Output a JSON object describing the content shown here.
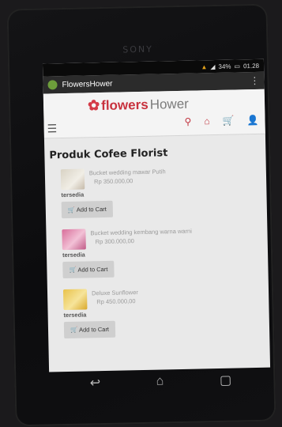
{
  "phone": {
    "brand": "SONY"
  },
  "status_bar": {
    "clock": "01.28",
    "signal_text": "34%"
  },
  "app_bar": {
    "title": "FlowersHower",
    "menu_icon": "kebab-menu-icon"
  },
  "site": {
    "logo_text_main": "flowers",
    "logo_text_accent": "Hower",
    "logo_icon": "flower-icon",
    "header_icons": [
      "search-icon",
      "home-icon",
      "cart-icon",
      "user-icon"
    ]
  },
  "page": {
    "title": "Produk Cofee Florist"
  },
  "products": [
    {
      "name": "Bucket wedding mawar Putih",
      "price": "Rp 350.000,00",
      "stock": "tersedia",
      "button_label": "Add to Cart"
    },
    {
      "name": "Bucket wedding kembang warna warni",
      "price": "Rp 300.000,00",
      "stock": "tersedia",
      "button_label": "Add to Cart"
    },
    {
      "name": "Deluxe Sunflower",
      "price": "Rp 450.000,00",
      "stock": "tersedia",
      "button_label": "Add to Cart"
    }
  ],
  "colors": {
    "accent": "#c8323e",
    "appbar": "#2b2b2b",
    "background": "#e9e9e9"
  }
}
